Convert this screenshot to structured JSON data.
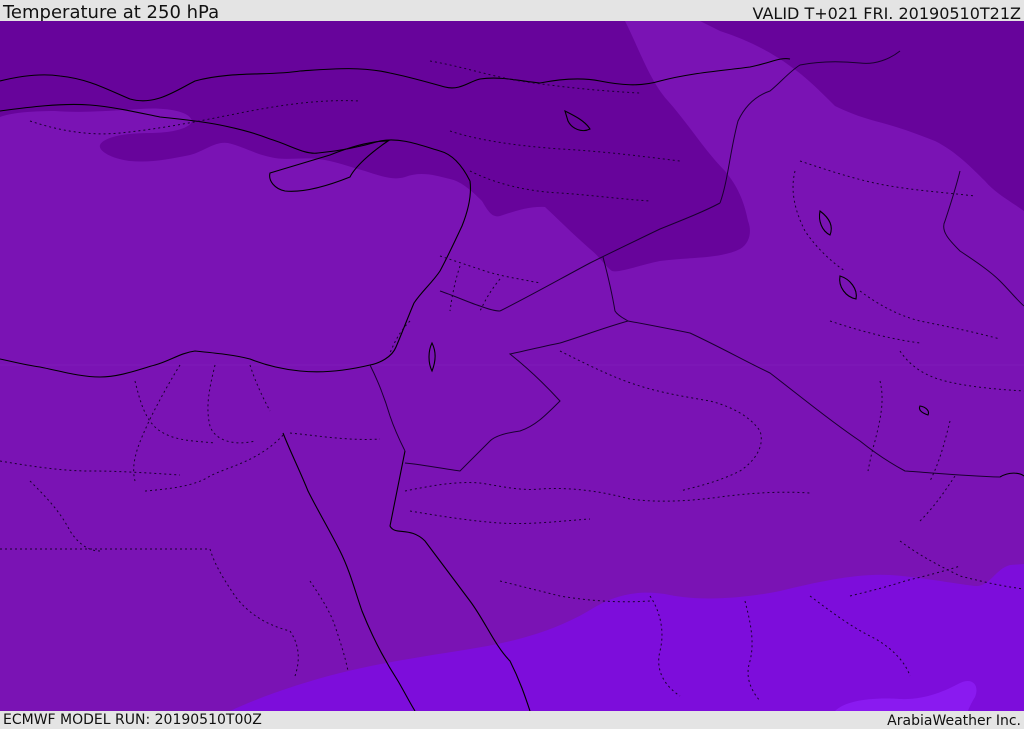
{
  "header": {
    "title": "Temperature at 250 hPa",
    "valid": "VALID T+021 FRI. 20190510T21Z"
  },
  "footer": {
    "model_run": "ECMWF MODEL RUN: 20190510T00Z",
    "credit": "ArabiaWeather Inc."
  },
  "map": {
    "field": "Temperature at 250 hPa",
    "colors": {
      "cold_band": "#67049b",
      "mid_band": "#7a13b4",
      "warm_band": "#7d0ddb",
      "warmest_patch": "#8a1af0",
      "coastline": "#000000",
      "borders": "#1a0030"
    }
  }
}
